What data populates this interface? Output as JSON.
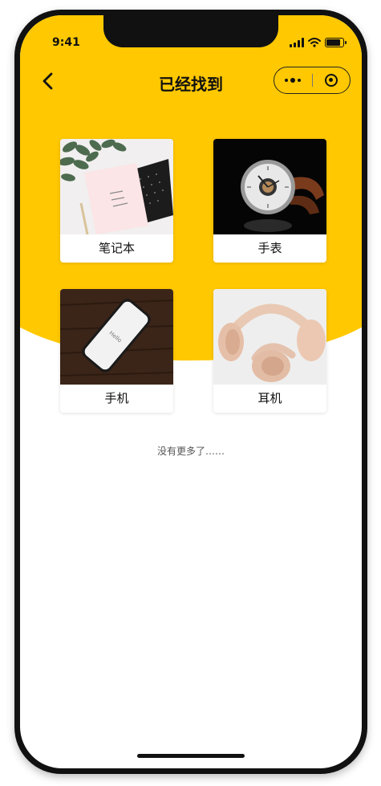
{
  "status_bar": {
    "time": "9:41",
    "icons": [
      "signal-icon",
      "wifi-icon",
      "battery-icon"
    ]
  },
  "nav": {
    "title": "已经找到",
    "back_icon": "chevron-left-icon",
    "capsule": {
      "more_icon": "more-dots-icon",
      "close_icon": "target-icon"
    }
  },
  "items": [
    {
      "label": "笔记本",
      "image": "notebook-photo"
    },
    {
      "label": "手表",
      "image": "watch-photo"
    },
    {
      "label": "手机",
      "image": "phone-photo"
    },
    {
      "label": "耳机",
      "image": "headphones-photo"
    }
  ],
  "footer": {
    "no_more": "没有更多了……"
  },
  "colors": {
    "accent": "#FFC800",
    "text": "#111111"
  }
}
